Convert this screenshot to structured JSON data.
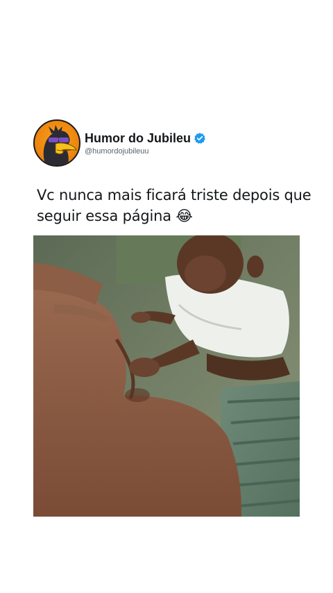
{
  "post": {
    "account_name": "Humor do Jubileu",
    "handle": "@humordojubileuu",
    "verified": true,
    "caption": "Vc nunca mais ficará triste depois que seguir essa página 😂"
  },
  "colors": {
    "verified_badge": "#1d9bf0",
    "avatar_background": "#f29418",
    "text": "#14171a",
    "handle_text": "#536471"
  },
  "icons": {
    "verified": "verified-badge-icon"
  }
}
